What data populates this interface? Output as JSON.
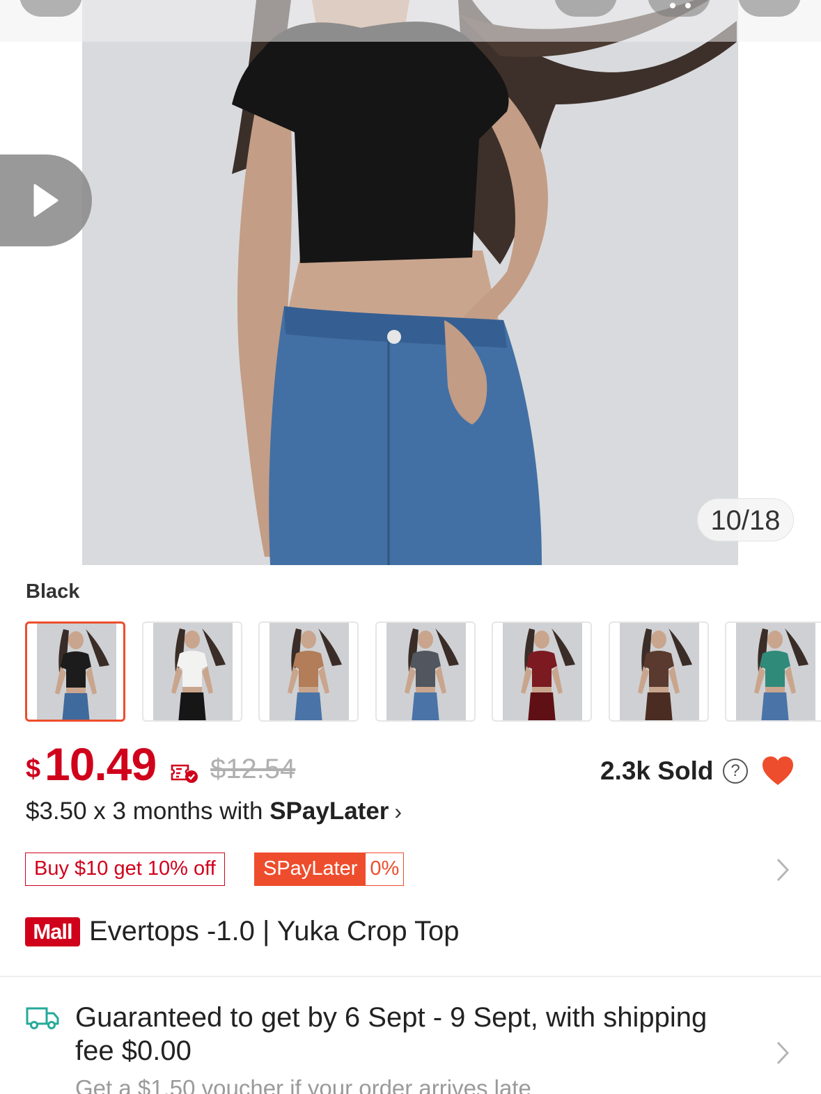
{
  "gallery": {
    "counter": "10/18"
  },
  "variation": {
    "label": "Black",
    "options": [
      {
        "name": "Black",
        "top": "#1c1c1c",
        "bottom": "#3f6a9d",
        "skin": "#c9a58d"
      },
      {
        "name": "White",
        "top": "#f2f2f0",
        "bottom": "#161616",
        "skin": "#c9a58d"
      },
      {
        "name": "Tan",
        "top": "#b27d58",
        "bottom": "#4a74a8",
        "skin": "#c9a58d"
      },
      {
        "name": "Grey",
        "top": "#52565e",
        "bottom": "#4a74a8",
        "skin": "#c9a58d"
      },
      {
        "name": "Maroon",
        "top": "#7b1a21",
        "bottom": "#5e1014",
        "skin": "#c9a58d"
      },
      {
        "name": "Brown",
        "top": "#5a3a2e",
        "bottom": "#4a2c22",
        "skin": "#c9a58d"
      },
      {
        "name": "Teal",
        "top": "#2f8a7a",
        "bottom": "#4a74a8",
        "skin": "#c9a58d"
      }
    ]
  },
  "price": {
    "currency": "$",
    "current": "10.49",
    "original": "$12.54",
    "sold": "2.3k Sold",
    "help": "?",
    "installment_prefix": "$3.50 x 3 months with ",
    "installment_brand": "SPayLater",
    "installment_arrow": "›"
  },
  "tags": {
    "promo": "Buy $10 get 10% off",
    "spaylater": "SPayLater",
    "spaylater_rate": "0%"
  },
  "product": {
    "badge": "Mall",
    "title": "Evertops -1.0 | Yuka Crop Top"
  },
  "shipping": {
    "text": "Guaranteed to get by 6 Sept - 9 Sept, with shipping fee $0.00",
    "sub": "Get a $1.50 voucher if your order arrives late"
  },
  "colors": {
    "brand": "#ee4d2d",
    "price_red": "#d0011b",
    "truck_teal": "#26aa99"
  },
  "icons": [
    "back-icon",
    "share-icon",
    "cart-icon",
    "more-icon",
    "play-icon",
    "voucher-icon",
    "help-icon",
    "heart-icon",
    "chevron-right-icon",
    "truck-icon"
  ]
}
